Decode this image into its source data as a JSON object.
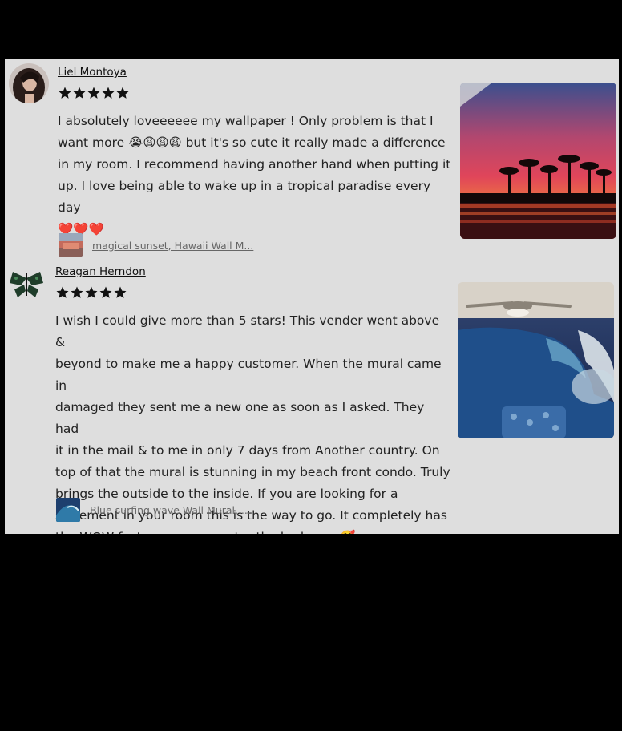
{
  "reviews": [
    {
      "reviewer": "Liel Montoya",
      "rating": 5,
      "text_lines": [
        "I absolutely loveeeeee my wallpaper ! Only problem is that I",
        "want more 😭😩😩😩 but it's so cute it really made a difference",
        "in my room. I recommend having another hand when putting it",
        "up. I love being able to wake up in a tropical paradise every day",
        "❤️❤️❤️"
      ],
      "listing_title": "magical sunset, Hawaii Wall M...",
      "photo_icon": "sunset-palm-trees-photo"
    },
    {
      "reviewer": "Reagan Herndon",
      "rating": 5,
      "text_lines": [
        "I wish I could give more than 5 stars! This vender went above &",
        "beyond to make me a happy customer. When the mural came in",
        "damaged they sent me a new one as soon as I asked. They had",
        "it in the mail & to me in only 7 days from Another country. On",
        "top of that the mural is stunning in my beach front condo. Truly",
        "brings the outside to the inside. If you are looking for a",
        "statement in your room this is the way to go. It completely has",
        "the WOW factor once you enter the bedroom 🥰"
      ],
      "listing_title": "Blue surfing wave Wall Mural, ...",
      "photo_icon": "ocean-wave-bedroom-photo"
    }
  ],
  "colors": {
    "panel_bg": "#dedede",
    "star": "#111111",
    "page_bg": "#000000"
  }
}
